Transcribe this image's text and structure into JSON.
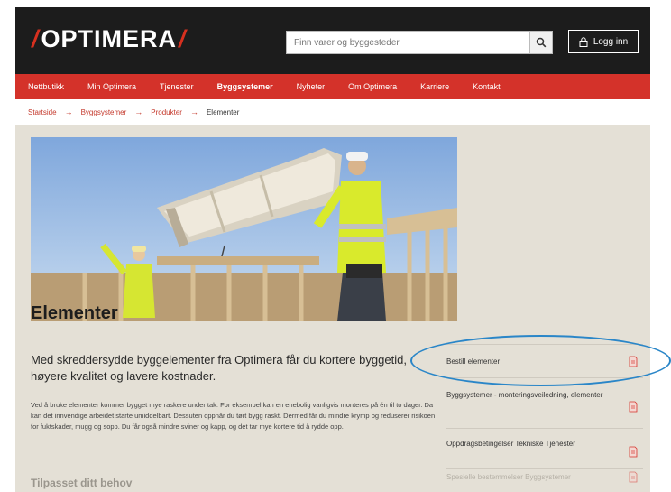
{
  "header": {
    "logo_text": "OPTIMERA",
    "search_placeholder": "Finn varer og byggesteder",
    "login_label": "Logg inn"
  },
  "nav": {
    "items": [
      {
        "label": "Nettbutikk"
      },
      {
        "label": "Min Optimera"
      },
      {
        "label": "Tjenester"
      },
      {
        "label": "Byggsystemer"
      },
      {
        "label": "Nyheter"
      },
      {
        "label": "Om Optimera"
      },
      {
        "label": "Karriere"
      },
      {
        "label": "Kontakt"
      }
    ],
    "active": "Byggsystemer"
  },
  "breadcrumb": {
    "items": [
      "Startside",
      "Byggsystemer",
      "Produkter"
    ],
    "current": "Elementer",
    "separator": "→"
  },
  "content": {
    "title": "Elementer",
    "lead": "Med skreddersydde byggelementer fra Optimera får du kortere byggetid, høyere kvalitet og lavere kostnader.",
    "body": "Ved å bruke elementer kommer bygget mye raskere under tak. For eksempel kan en enebolig vanligvis monteres på én til to dager. Da kan det innvendige arbeidet starte umiddelbart. Dessuten oppnår du tørt bygg raskt. Dermed får du mindre krymp og reduserer risikoen for fuktskader, mugg og sopp. Du får også mindre sviner og kapp, og det tar mye kortere tid å rydde opp.",
    "subheading": "Tilpasset ditt behov"
  },
  "sidebar": {
    "links": [
      {
        "label": "Bestill elementer"
      },
      {
        "label": "Byggsystemer - monteringsveiledning, elementer"
      },
      {
        "label": "Oppdragsbetingelser Tekniske Tjenester"
      },
      {
        "label": "Spesielle bestemmelser Byggsystemer"
      }
    ]
  },
  "colors": {
    "brand_red": "#d4322a",
    "header_dark": "#1c1c1c",
    "page_bg": "#e4e0d6",
    "highlight_blue": "#2a86c8"
  },
  "icons": {
    "search": "search-icon",
    "login": "lock-icon",
    "pdf": "pdf-icon",
    "breadcrumb_separator": "arrow-right-icon"
  }
}
